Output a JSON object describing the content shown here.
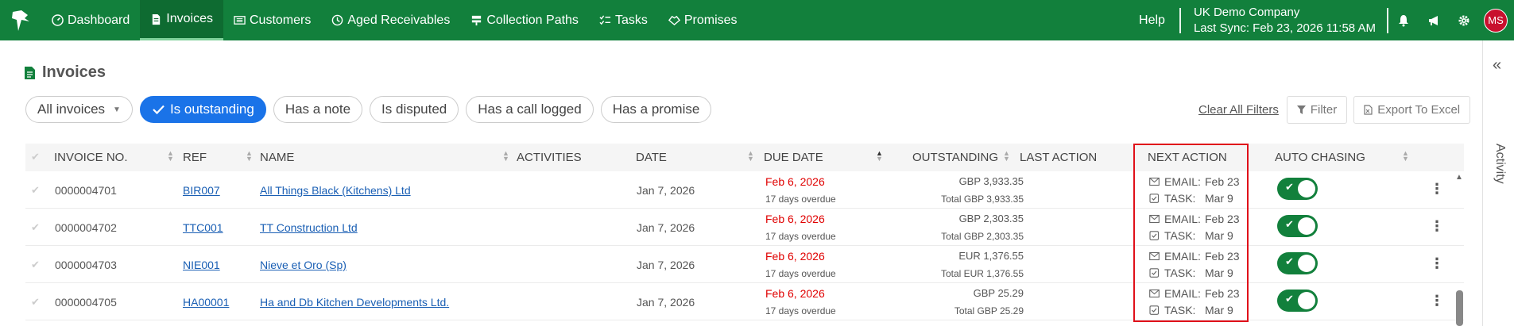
{
  "nav": {
    "items": [
      {
        "label": "Dashboard",
        "icon": "gauge-icon"
      },
      {
        "label": "Invoices",
        "icon": "document-icon",
        "active": true
      },
      {
        "label": "Customers",
        "icon": "address-card-icon"
      },
      {
        "label": "Aged Receivables",
        "icon": "clock-icon"
      },
      {
        "label": "Collection Paths",
        "icon": "signpost-icon"
      },
      {
        "label": "Tasks",
        "icon": "checklist-icon"
      },
      {
        "label": "Promises",
        "icon": "handshake-icon"
      }
    ],
    "help": "Help",
    "company": "UK Demo Company",
    "last_sync": "Last Sync: Feb 23, 2026 11:58 AM",
    "avatar": "MS"
  },
  "page": {
    "title": "Invoices"
  },
  "filters": {
    "dropdown": "All invoices",
    "chips": [
      "Is outstanding",
      "Has a note",
      "Is disputed",
      "Has a call logged",
      "Has a promise"
    ],
    "selected": "Is outstanding",
    "clear_all": "Clear All Filters",
    "filter_button": "Filter",
    "export_button": "Export To Excel"
  },
  "activity_panel": {
    "label": "Activity"
  },
  "table": {
    "headers": {
      "invoice_no": "INVOICE NO.",
      "ref": "REF",
      "name": "NAME",
      "activities": "ACTIVITIES",
      "date": "DATE",
      "due_date": "DUE DATE",
      "outstanding": "OUTSTANDING",
      "last_action": "LAST ACTION",
      "next_action": "NEXT ACTION",
      "auto_chasing": "AUTO CHASING"
    },
    "rows": [
      {
        "invoice_no": "0000004701",
        "ref": "BIR007",
        "name": "All Things Black (Kitchens) Ltd",
        "date": "Jan 7, 2026",
        "due_date": "Feb 6, 2026",
        "overdue": "17 days overdue",
        "outstanding": "GBP 3,933.35",
        "total": "Total GBP 3,933.35",
        "email_label": "EMAIL:",
        "email_date": "Feb 23",
        "task_label": "TASK:",
        "task_date": "Mar 9",
        "auto_chasing": true
      },
      {
        "invoice_no": "0000004702",
        "ref": "TTC001",
        "name": "TT Construction Ltd",
        "date": "Jan 7, 2026",
        "due_date": "Feb 6, 2026",
        "overdue": "17 days overdue",
        "outstanding": "GBP 2,303.35",
        "total": "Total GBP 2,303.35",
        "email_label": "EMAIL:",
        "email_date": "Feb 23",
        "task_label": "TASK:",
        "task_date": "Mar 9",
        "auto_chasing": true
      },
      {
        "invoice_no": "0000004703",
        "ref": "NIE001",
        "name": "Nieve et Oro (Sp)",
        "date": "Jan 7, 2026",
        "due_date": "Feb 6, 2026",
        "overdue": "17 days overdue",
        "outstanding": "EUR 1,376.55",
        "total": "Total EUR 1,376.55",
        "email_label": "EMAIL:",
        "email_date": "Feb 23",
        "task_label": "TASK:",
        "task_date": "Mar 9",
        "auto_chasing": true
      },
      {
        "invoice_no": "0000004705",
        "ref": "HA00001",
        "name": "Ha and Db Kitchen Developments Ltd.",
        "date": "Jan 7, 2026",
        "due_date": "Feb 6, 2026",
        "overdue": "17 days overdue",
        "outstanding": "GBP 25.29",
        "total": "Total GBP 25.29",
        "email_label": "EMAIL:",
        "email_date": "Feb 23",
        "task_label": "TASK:",
        "task_date": "Mar 9",
        "auto_chasing": true
      }
    ]
  },
  "colors": {
    "brand": "#12803c",
    "selected_chip": "#1a73e8",
    "overdue": "#e00000",
    "highlight_box": "#e0101a"
  }
}
